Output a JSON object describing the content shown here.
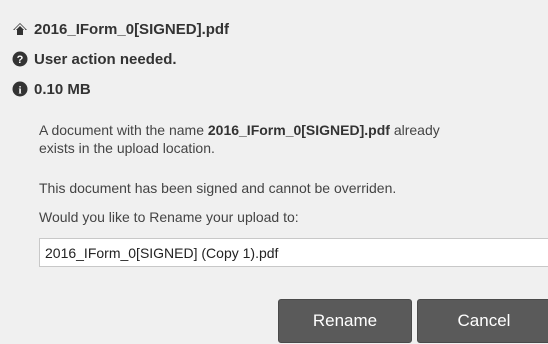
{
  "file": {
    "name": "2016_IForm_0[SIGNED].pdf",
    "icon": "upload-icon"
  },
  "status": {
    "text": "User action needed.",
    "icon": "question-circle-icon"
  },
  "size": {
    "text": "0.10 MB",
    "icon": "info-circle-icon"
  },
  "message": {
    "line1_prefix": "A document with the name ",
    "line1_filename": "2016_IForm_0[SIGNED].pdf",
    "line1_suffix": " already",
    "line1_cont": "exists in the upload location.",
    "line2": "This document has been signed and cannot be overriden.",
    "line3": "Would you like to Rename your upload to:"
  },
  "rename_field": {
    "value": "2016_IForm_0[SIGNED] (Copy 1).pdf"
  },
  "buttons": {
    "rename": "Rename",
    "cancel": "Cancel"
  },
  "colors": {
    "panel_bg": "#f0f0f0",
    "button_bg": "#5a5a5a",
    "text": "#333333"
  }
}
